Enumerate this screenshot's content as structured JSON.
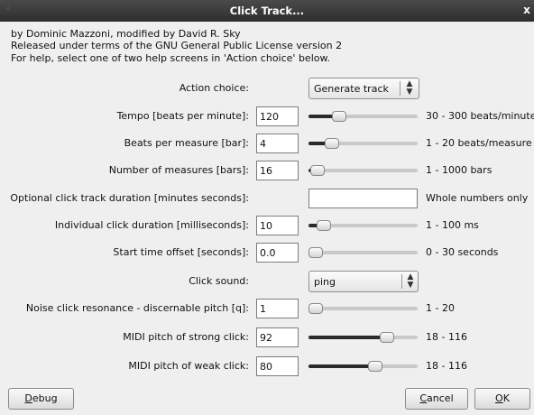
{
  "window": {
    "title": "Click Track...",
    "close_glyph": "x"
  },
  "info_lines": [
    "by Dominic Mazzoni, modified by David R. Sky",
    "Released under terms of the GNU General Public License version 2",
    "For help, select one of two help screens in 'Action choice' below."
  ],
  "action_choice": {
    "label": "Action choice:",
    "value": "Generate track"
  },
  "tempo": {
    "label": "Tempo [beats per minute]:",
    "value": "120",
    "range": "30 - 300 beats/minute",
    "level": 0.25
  },
  "beats": {
    "label": "Beats per measure [bar]:",
    "value": "4",
    "range": "1 - 20 beats/measure",
    "level": 0.17
  },
  "measures": {
    "label": "Number of measures [bars]:",
    "value": "16",
    "range": "1 - 1000 bars",
    "level": 0.02
  },
  "duration": {
    "label": "Optional click track duration [minutes seconds]:",
    "value": "",
    "range": "Whole numbers only"
  },
  "click_duration": {
    "label": "Individual click duration [milliseconds]:",
    "value": "10",
    "range": "1 - 100 ms",
    "level": 0.09
  },
  "offset": {
    "label": "Start time offset [seconds]:",
    "value": "0.0",
    "range": "0 - 30 seconds",
    "level": 0.0
  },
  "click_sound": {
    "label": "Click sound:",
    "value": "ping"
  },
  "resonance": {
    "label": "Noise click resonance - discernable pitch [q]:",
    "value": "1",
    "range": "1 - 20",
    "level": 0.0
  },
  "strong_pitch": {
    "label": "MIDI pitch of strong click:",
    "value": "92",
    "range": "18 - 116",
    "level": 0.755
  },
  "weak_pitch": {
    "label": "MIDI pitch of weak click:",
    "value": "80",
    "range": "18 - 116",
    "level": 0.633
  },
  "buttons": {
    "debug": {
      "mnemonic": "D",
      "rest": "ebug"
    },
    "cancel": {
      "mnemonic": "C",
      "rest": "ancel"
    },
    "ok": {
      "mnemonic": "O",
      "rest": "K"
    }
  },
  "icons": {
    "combo_arrow": "updown-arrows-icon",
    "window_menu": "window-menu-icon",
    "close": "close-icon"
  }
}
